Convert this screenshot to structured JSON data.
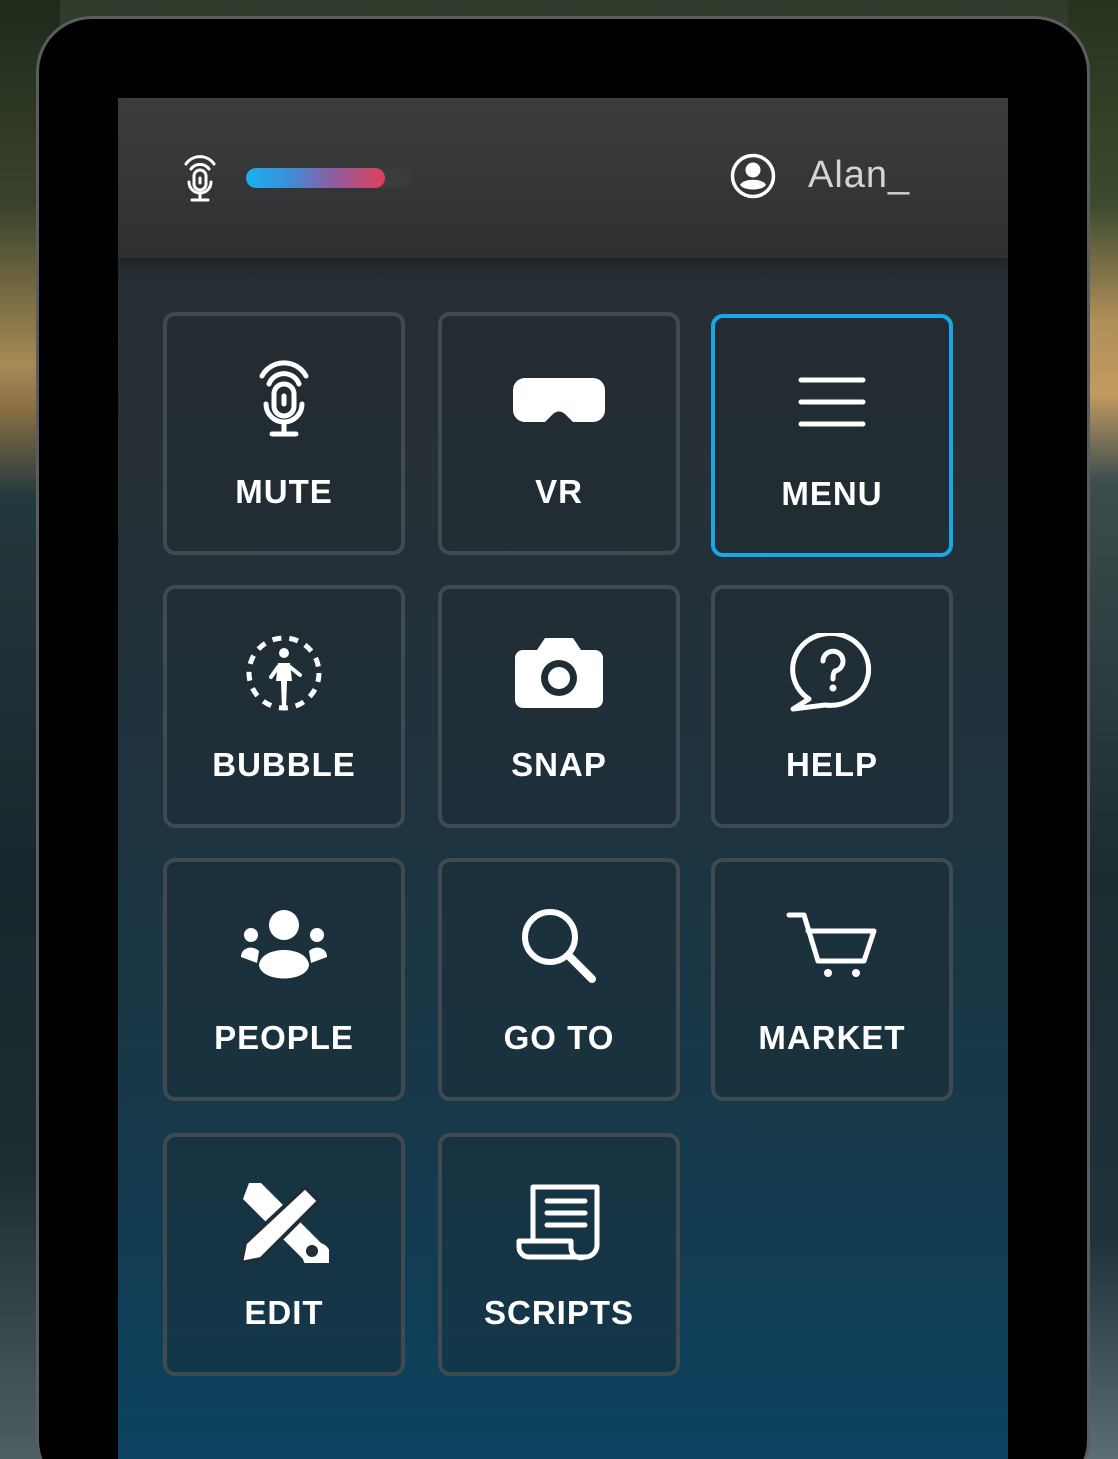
{
  "header": {
    "mic_icon": "microphone-signal-icon",
    "audio_level": 0.84,
    "audio_level_colors": [
      "#1ab0ee",
      "#8a5fa8",
      "#e0405a"
    ],
    "user_icon": "user-avatar-icon",
    "username": "Alan_"
  },
  "accent_color": "#1aa7e8",
  "tiles": [
    {
      "label": "MUTE",
      "icon": "microphone-icon",
      "active": false
    },
    {
      "label": "VR",
      "icon": "vr-headset-icon",
      "active": false
    },
    {
      "label": "MENU",
      "icon": "hamburger-menu-icon",
      "active": true
    },
    {
      "label": "BUBBLE",
      "icon": "bubble-person-icon",
      "active": false
    },
    {
      "label": "SNAP",
      "icon": "camera-icon",
      "active": false
    },
    {
      "label": "HELP",
      "icon": "question-bubble-icon",
      "active": false
    },
    {
      "label": "PEOPLE",
      "icon": "people-group-icon",
      "active": false
    },
    {
      "label": "GO TO",
      "icon": "search-icon",
      "active": false
    },
    {
      "label": "MARKET",
      "icon": "shopping-cart-icon",
      "active": false
    },
    {
      "label": "EDIT",
      "icon": "pencil-wrench-icon",
      "active": false
    },
    {
      "label": "SCRIPTS",
      "icon": "script-scroll-icon",
      "active": false
    }
  ]
}
